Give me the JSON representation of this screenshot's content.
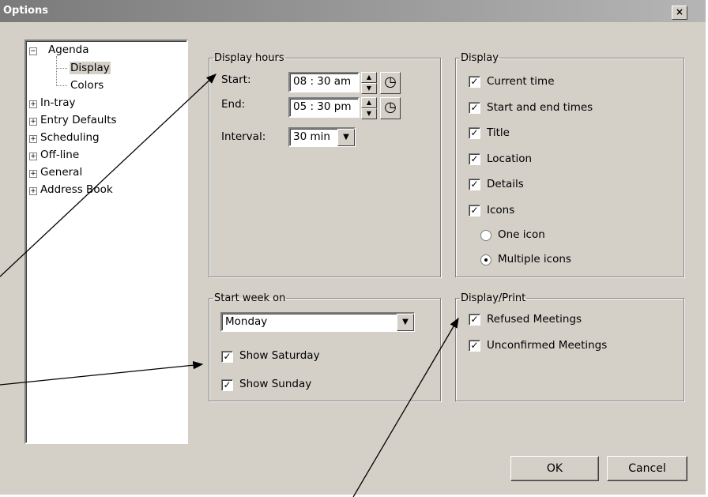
{
  "window": {
    "title": "Options",
    "close_glyph": "×"
  },
  "tree": {
    "agenda": "Agenda",
    "display": "Display",
    "colors": "Colors",
    "items": [
      "In-tray",
      "Entry Defaults",
      "Scheduling",
      "Off-line",
      "General",
      "Address Book"
    ]
  },
  "display_hours": {
    "legend": "Display hours",
    "start_label": "Start:",
    "start_value": "08 : 30  am",
    "end_label": "End:",
    "end_value": "05 : 30  pm",
    "interval_label": "Interval:",
    "interval_value": "30 min"
  },
  "display": {
    "legend": "Display",
    "options": [
      {
        "label": "Current time",
        "checked": true
      },
      {
        "label": "Start and end times",
        "checked": true
      },
      {
        "label": "Title",
        "checked": true
      },
      {
        "label": "Location",
        "checked": true
      },
      {
        "label": "Details",
        "checked": true
      },
      {
        "label": "Icons",
        "checked": true
      }
    ],
    "radio_one": "One icon",
    "radio_multiple": "Multiple icons",
    "radio_selected": "Multiple icons"
  },
  "start_week": {
    "legend": "Start week on",
    "day_value": "Monday",
    "show_saturday": "Show Saturday",
    "show_sunday": "Show Sunday"
  },
  "display_print": {
    "legend": "Display/Print",
    "refused": "Refused Meetings",
    "unconfirmed": "Unconfirmed Meetings"
  },
  "buttons": {
    "ok": "OK",
    "cancel": "Cancel"
  },
  "icons": {
    "spin_up": "▲",
    "spin_down": "▼",
    "clock": "clock-icon",
    "dropdown": "▼",
    "check": "✓"
  }
}
